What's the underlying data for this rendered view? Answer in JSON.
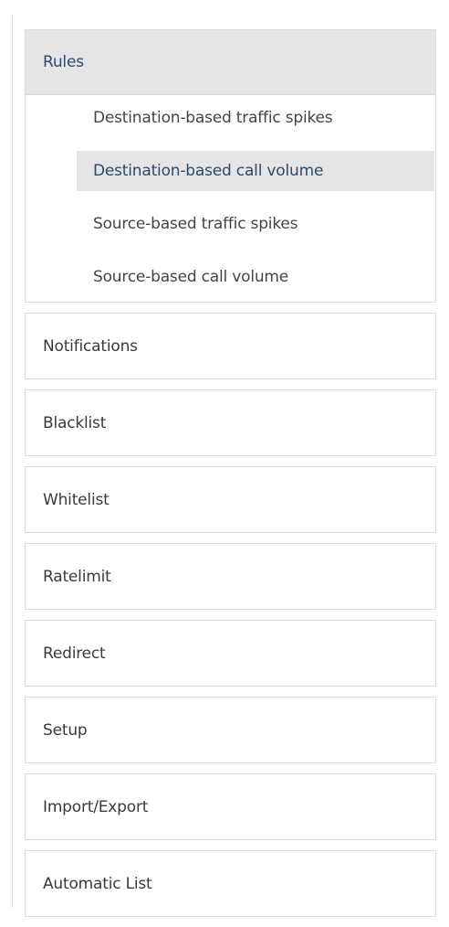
{
  "menu": {
    "rules": {
      "label": "Rules",
      "items": [
        {
          "label": "Destination-based traffic spikes",
          "active": false
        },
        {
          "label": "Destination-based call volume",
          "active": true
        },
        {
          "label": "Source-based traffic spikes",
          "active": false
        },
        {
          "label": "Source-based call volume",
          "active": false
        }
      ]
    },
    "notifications": {
      "label": "Notifications"
    },
    "blacklist": {
      "label": "Blacklist"
    },
    "whitelist": {
      "label": "Whitelist"
    },
    "ratelimit": {
      "label": "Ratelimit"
    },
    "redirect": {
      "label": "Redirect"
    },
    "setup": {
      "label": "Setup"
    },
    "import_export": {
      "label": "Import/Export"
    },
    "automatic_list": {
      "label": "Automatic List"
    }
  },
  "colors": {
    "active_background": "#e5e5e5",
    "active_text": "#2c4a6e",
    "border": "#dcdcdc"
  }
}
